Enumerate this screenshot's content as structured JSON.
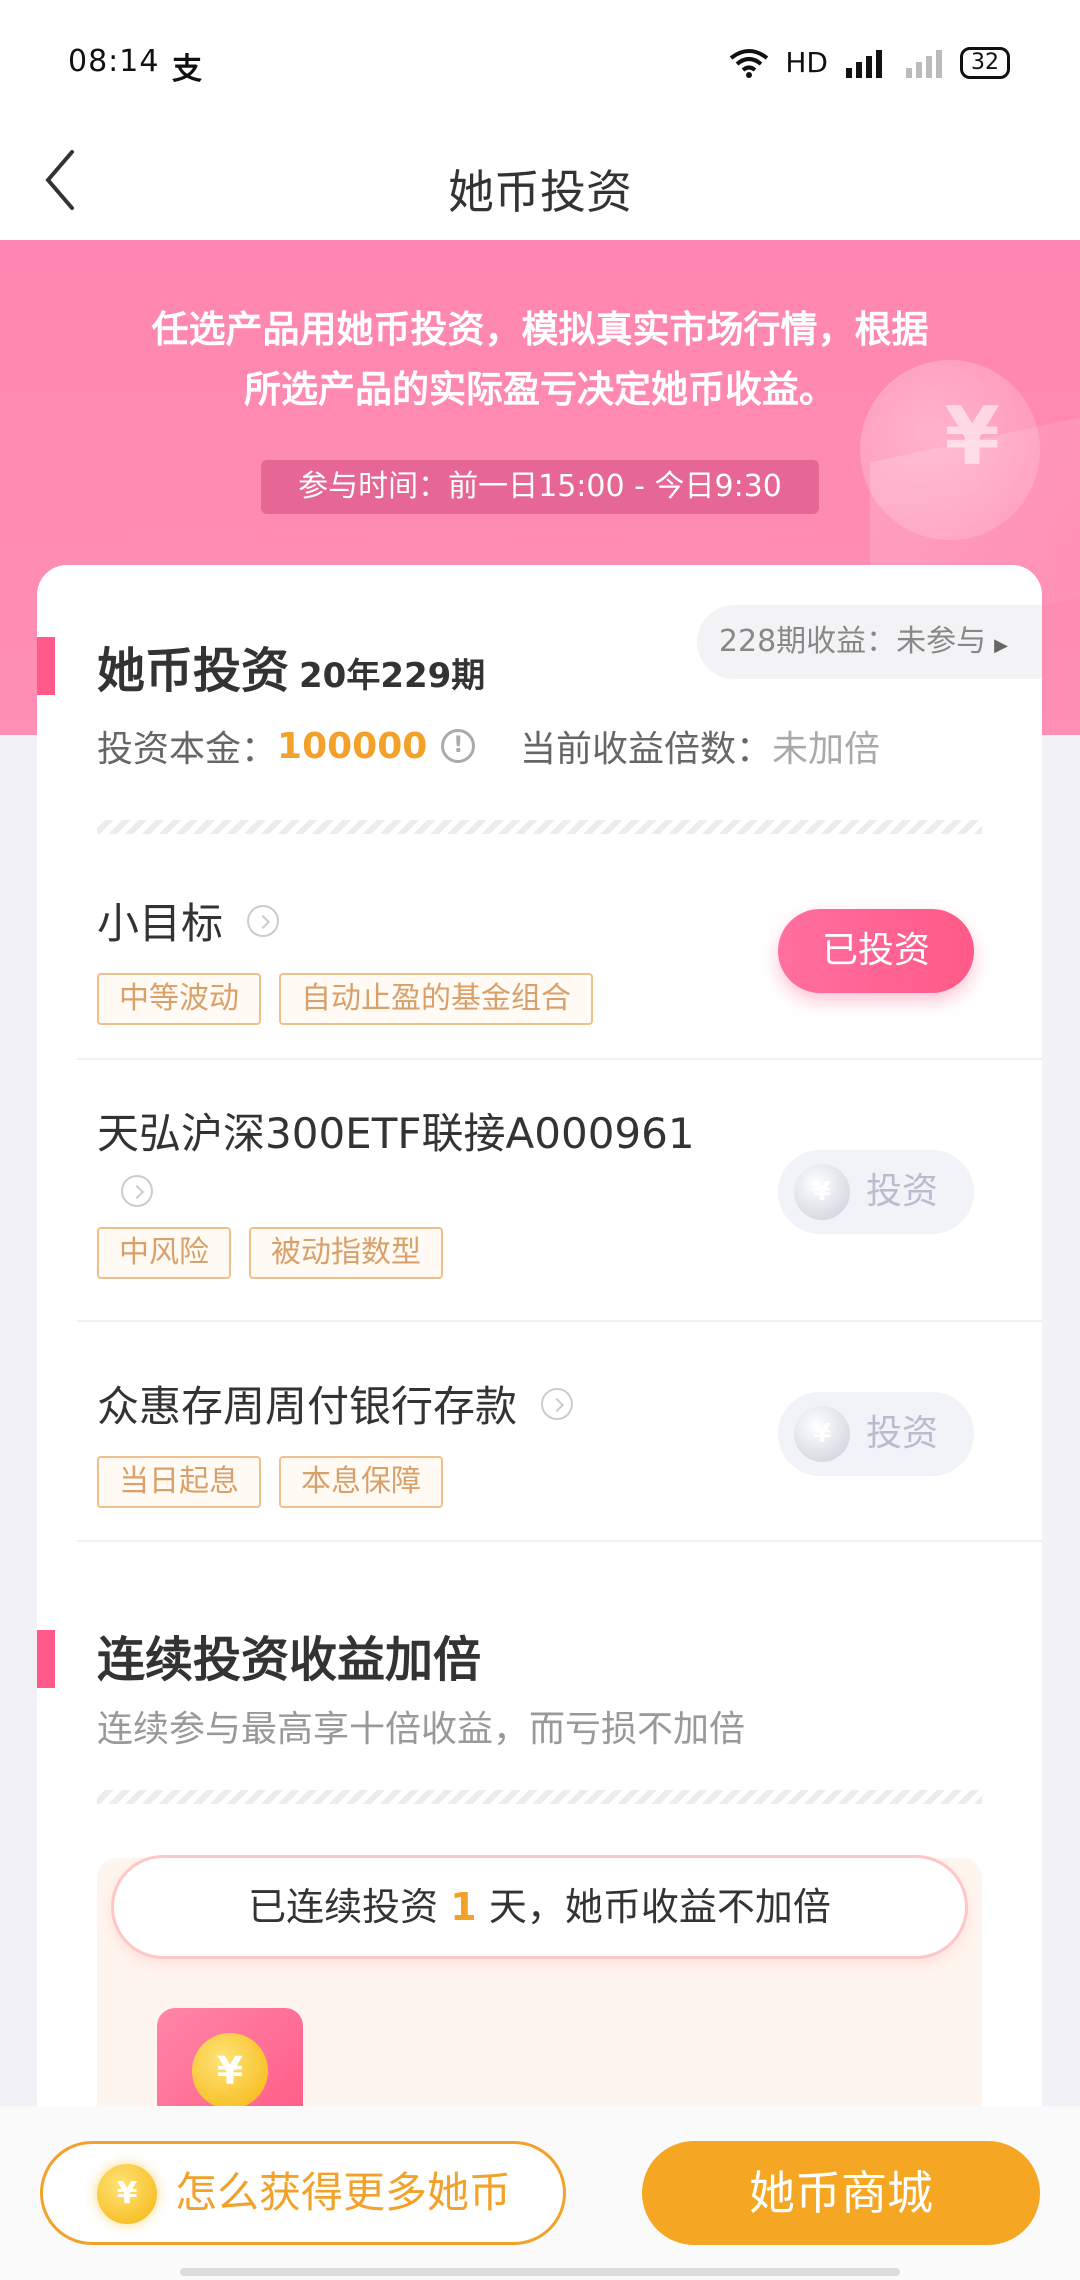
{
  "status_bar": {
    "time": "08:14",
    "app_icon": "alipay-icon",
    "network": "HD",
    "signal": "4G",
    "battery": "32"
  },
  "nav": {
    "title": "她币投资",
    "back_icon": "chevron-left-icon"
  },
  "hero": {
    "description_line1": "任选产品用她币投资，模拟真实市场行情，根据",
    "description_line2": "所选产品的实际盈亏决定她币收益。",
    "participation_time": "参与时间：前一日15:00 - 今日9:30"
  },
  "investment": {
    "title": "她币投资",
    "period": "20年229期",
    "prev_income": "228期收益：未参与",
    "capital_label": "投资本金：",
    "capital_value": "100000",
    "multiplier_label": "当前收益倍数：",
    "multiplier_value": "未加倍"
  },
  "products": [
    {
      "name": "小目标",
      "tags": [
        "中等波动",
        "自动止盈的基金组合"
      ],
      "button": "已投资",
      "invested": true
    },
    {
      "name": "天弘沪深300ETF联接A000961",
      "tags": [
        "中风险",
        "被动指数型"
      ],
      "button": "投资",
      "invested": false
    },
    {
      "name": "众惠存周周付银行存款",
      "tags": [
        "当日起息",
        "本息保障"
      ],
      "button": "投资",
      "invested": false
    }
  ],
  "bonus": {
    "title": "连续投资收益加倍",
    "subtitle": "连续参与最高享十倍收益，而亏损不加倍",
    "streak_prefix": "已连续投资",
    "streak_days": "1",
    "streak_suffix": "天，她币收益不加倍"
  },
  "bottom": {
    "more_label": "怎么获得更多她币",
    "mall_label": "她币商城"
  },
  "colors": {
    "accent_pink": "#ff5a8a",
    "accent_orange": "#f5a623"
  }
}
